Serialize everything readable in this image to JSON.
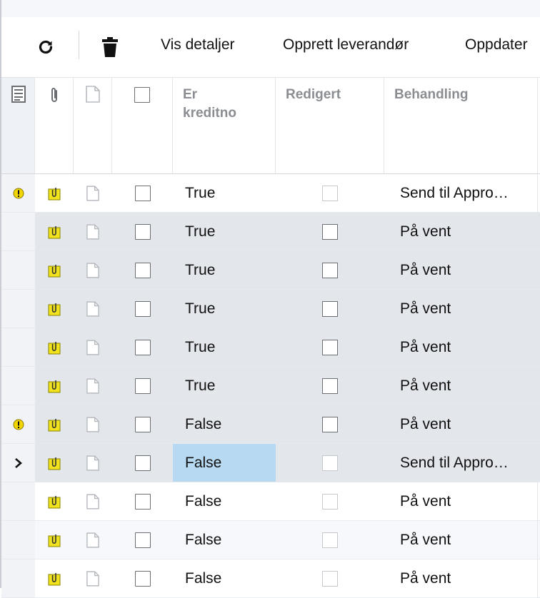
{
  "toolbar": {
    "refresh_icon": "refresh-icon",
    "delete_icon": "trash-icon",
    "details_label": "Vis detaljer",
    "create_supplier_label": "Opprett leverandør",
    "update_label": "Oppdater"
  },
  "columns": {
    "notes_icon": "document-list-icon",
    "attachment_icon": "paperclip-icon",
    "file_icon": "file-icon",
    "er_kreditnota": "Er kreditno",
    "er_kreditnota_line1": "Er",
    "er_kreditnota_line2": "kreditno",
    "redigert": "Redigert",
    "behandling": "Behandling"
  },
  "colors": {
    "selected_cell": "#b7d9f1",
    "warning": "#f2d600",
    "attachment": "#e8d800"
  },
  "rows": [
    {
      "indicator": "warning",
      "credit": "True",
      "edited_disabled": true,
      "processing": "Send til Appro…"
    },
    {
      "indicator": "",
      "credit": "True",
      "edited_disabled": false,
      "processing": "På vent"
    },
    {
      "indicator": "",
      "credit": "True",
      "edited_disabled": false,
      "processing": "På vent"
    },
    {
      "indicator": "",
      "credit": "True",
      "edited_disabled": false,
      "processing": "På vent"
    },
    {
      "indicator": "",
      "credit": "True",
      "edited_disabled": false,
      "processing": "På vent"
    },
    {
      "indicator": "",
      "credit": "True",
      "edited_disabled": false,
      "processing": "På vent"
    },
    {
      "indicator": "warning",
      "credit": "False",
      "edited_disabled": false,
      "processing": "På vent"
    },
    {
      "indicator": "current",
      "credit": "False",
      "edited_disabled": true,
      "processing": "Send til Appro…"
    },
    {
      "indicator": "",
      "credit": "False",
      "edited_disabled": true,
      "processing": "På vent"
    },
    {
      "indicator": "",
      "credit": "False",
      "edited_disabled": true,
      "processing": "På vent"
    },
    {
      "indicator": "",
      "credit": "False",
      "edited_disabled": true,
      "processing": "På vent"
    }
  ]
}
